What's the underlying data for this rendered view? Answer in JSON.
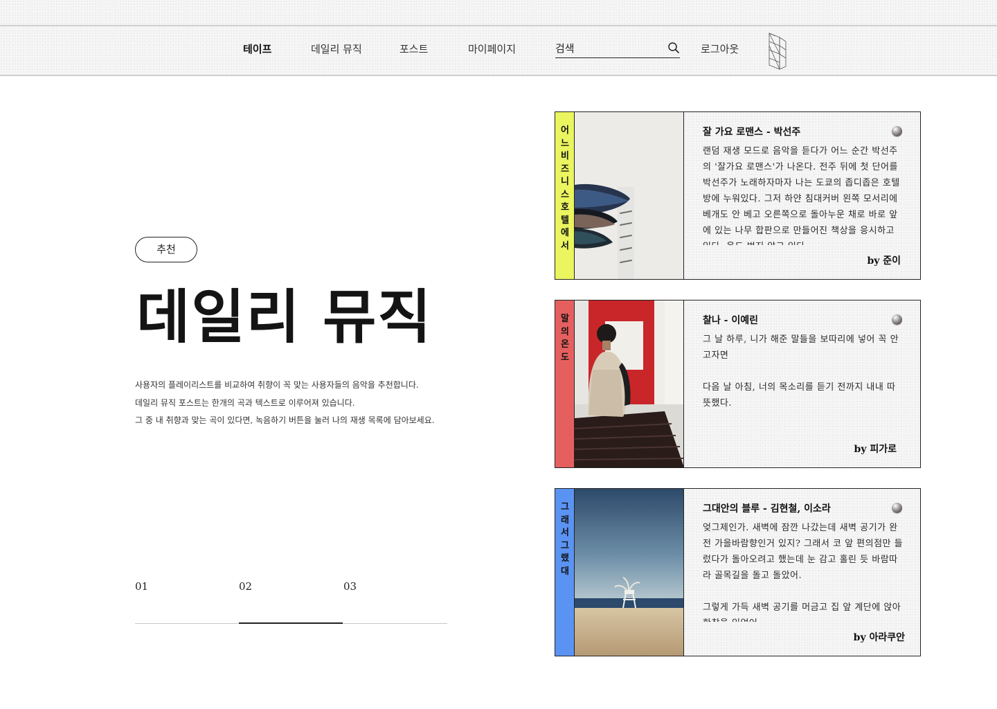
{
  "nav": {
    "items": [
      {
        "label": "테이프",
        "active": true
      },
      {
        "label": "데일리 뮤직",
        "active": false
      },
      {
        "label": "포스트",
        "active": false
      },
      {
        "label": "마이페이지",
        "active": false
      }
    ],
    "search_placeholder": "검색",
    "logout_label": "로그아웃"
  },
  "hero": {
    "tag": "추천",
    "title": "데일리 뮤직",
    "description": [
      "사용자의 플레이리스트를 비교하여 취향이 꼭 맞는 사용자들의 음악을 추천합니다.",
      "데일리 뮤직 포스트는 한개의 곡과 텍스트로 이루어져 있습니다.",
      "그 중 내 취향과 맞는 곡이 있다면, 녹음하기 버튼을 눌러 나의 재생 목록에 담아보세요."
    ]
  },
  "pager": {
    "pages": [
      "01",
      "02",
      "03"
    ],
    "active_index": 1
  },
  "cards": [
    {
      "side_title": "어느 비즈니스 호텔에서",
      "side_color": "#eaf55f",
      "song": "잘 가요 로맨스 - 박선주",
      "text": "랜덤 재생 모드로 음악을 듣다가 어느 순간 박선주의 '잘가요 로맨스'가 나온다. 전주 뒤에 첫 단어를 박선주가 노래하자마자 나는 도쿄의 좁디좁은 호텔방에 누워있다. 그저 하얀 침대커버 왼쪽 모서리에 베개도 안 베고 오른쪽으로 돌아누운 채로 바로 앞에 있는 나무 합판으로 만들어진 책상을 응시하고 있다. 옷도 벗지 않고 있다.",
      "author": "by 준이"
    },
    {
      "side_title": "말의 온도",
      "side_color": "#e65f5f",
      "song": "찰나 - 이예린",
      "text": "그 날 하루, 니가 해준 말들을 보따리에 넣어 꼭 안고자면\n\n다음 날 아침, 너의 목소리를 듣기 전까지 내내 따뜻했다.",
      "author": "by 피가로"
    },
    {
      "side_title": "그래서 그랬대",
      "side_color": "#5b93f2",
      "song": "그대안의 블루 - 김현철, 이소라",
      "text": "엊그제인가. 새벽에 잠깐 나갔는데 새벽 공기가 완전 가을바람향인거 있지? 그래서 코 앞 편의점만 들렀다가 돌아오려고 했는데 눈 감고 홀린 듯 바람따라 골목길을 돌고 돌았어.\n\n그렇게 가득 새벽 공기를 머금고 집 앞 계단에 앉아 한참을 있었어.",
      "author": "by 아라쿠안"
    }
  ],
  "colors": {
    "accent_yellow": "#eaf55f",
    "accent_red": "#e65f5f",
    "accent_blue": "#5b93f2",
    "text_dark": "#1a1a1a"
  }
}
